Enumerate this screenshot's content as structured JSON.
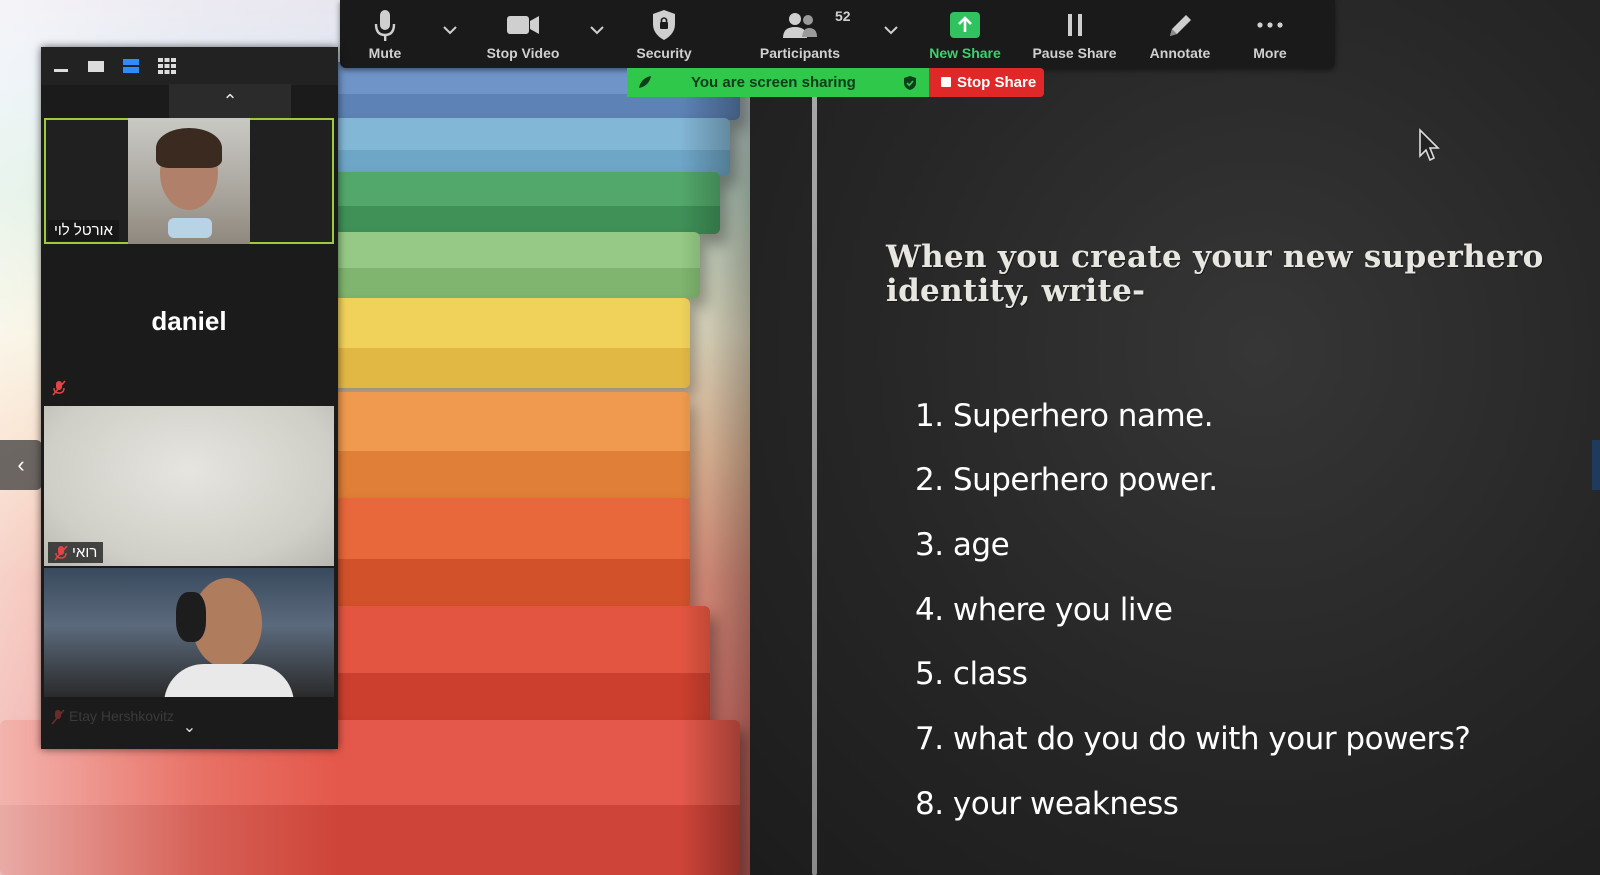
{
  "toolbar": {
    "mute": "Mute",
    "stop_video": "Stop Video",
    "security": "Security",
    "participants": "Participants",
    "participants_count": "52",
    "new_share": "New Share",
    "pause_share": "Pause Share",
    "annotate": "Annotate",
    "more": "More"
  },
  "share_bar": {
    "status": "You are screen sharing",
    "stop": "Stop Share"
  },
  "participants_panel": {
    "tiles": [
      {
        "name": "אורטל לוי"
      },
      {
        "name": "daniel"
      },
      {
        "name": "רואי"
      },
      {
        "name": "Etay Hershkovitz"
      }
    ]
  },
  "slide": {
    "heading": "When you create your new superhero identity, write-",
    "items": [
      "1. Superhero name.",
      "2. Superhero power.",
      "3. age",
      "4. where you live",
      "5. class",
      "7. what do you do with your powers?",
      "8. your weakness"
    ]
  },
  "colors": {
    "toolbar_bg": "#1a1a1a",
    "share_green": "#30c84a",
    "stop_red": "#e02828",
    "active_speaker": "#9ccc3d",
    "chalkboard": "#262626"
  },
  "icons": [
    "mic-icon",
    "video-camera-icon",
    "shield-icon",
    "participants-icon",
    "share-arrow-icon",
    "pause-icon",
    "pencil-icon",
    "more-dots-icon",
    "chevron-up-icon",
    "chevron-down-icon",
    "chevron-left-icon",
    "mic-off-icon",
    "cursor-icon"
  ]
}
